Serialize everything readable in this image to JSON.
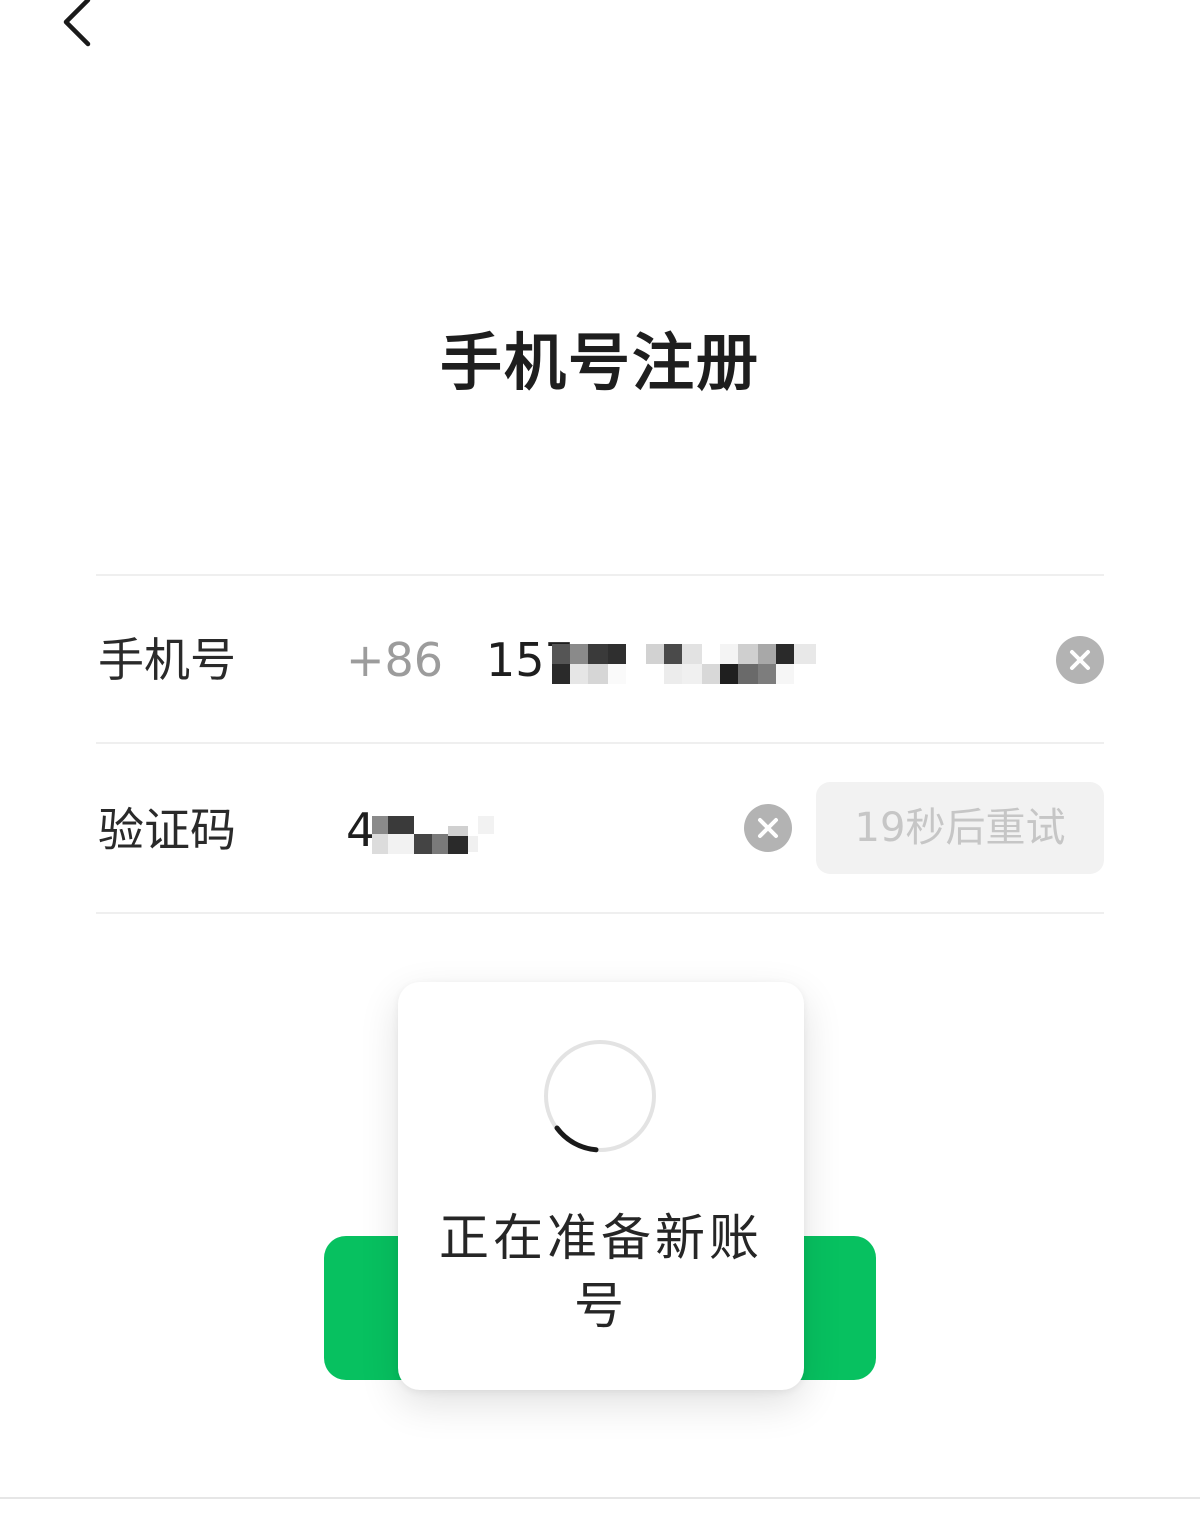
{
  "header": {
    "back_icon": "chevron-left-icon"
  },
  "page": {
    "title": "手机号注册"
  },
  "form": {
    "phone": {
      "label": "手机号",
      "country_code": "+86",
      "value_visible": "157",
      "clear_icon": "close-circle-icon"
    },
    "code": {
      "label": "验证码",
      "value_visible": "4",
      "clear_icon": "close-circle-icon",
      "retry_label": "19秒后重试"
    }
  },
  "primary_button": {
    "color": "#07c160"
  },
  "loading_toast": {
    "spinner_icon": "loading-spinner-icon",
    "message": "正在准备新账号"
  },
  "colors": {
    "accent": "#07c160",
    "muted_text": "#9c9c9c",
    "clear_icon_bg": "#b3b3b3"
  }
}
